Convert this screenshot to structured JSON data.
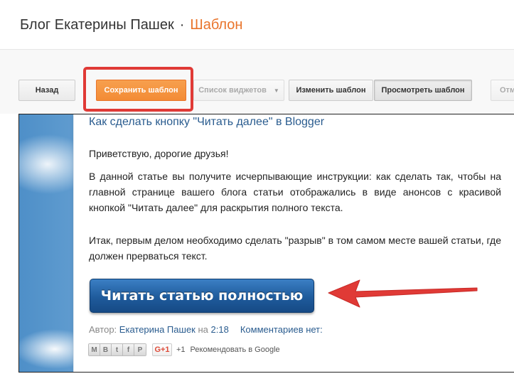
{
  "header": {
    "blog_name": "Блог Екатерины Пашек",
    "separator": "·",
    "section": "Шаблон"
  },
  "toolbar": {
    "back_label": "Назад",
    "save_label": "Сохранить шаблон",
    "widgets_label": "Список виджетов",
    "widgets_caret": "▼",
    "edit_label": "Изменить шаблон",
    "view_label": "Просмотреть шаблон",
    "more_label": "Отм"
  },
  "post": {
    "title": "Как сделать кнопку \"Читать далее\" в Blogger",
    "greeting": "Приветствую, дорогие друзья!",
    "paragraph1": "В данной статье вы получите исчерпывающие инструкции: как сделать так, чтобы на главной странице вашего блога статьи отображались в виде анонсов с красивой кнопкой \"Читать далее\" для раскрытия полного текста.",
    "paragraph2": "Итак, первым делом необходимо сделать \"разрыв\" в том самом месте вашей статьи, где должен прерваться текст.",
    "read_more_label": "Читать статью полностью",
    "author_prefix": "Автор:",
    "author": "Екатерина Пашек",
    "time_prefix": "на",
    "time": "2:18",
    "comments": "Комментариев нет:"
  },
  "share": {
    "icons": [
      "email-icon",
      "blogthis-icon",
      "twitter-icon",
      "facebook-icon",
      "pinterest-icon"
    ],
    "icon_glyphs": [
      "M",
      "B",
      "t",
      "f",
      "P"
    ],
    "gplus_label": "G+1",
    "gplus_count": "+1",
    "recommend_label": "Рекомендовать в Google"
  },
  "colors": {
    "accent": "#e9742b",
    "save_button": "#f38b35",
    "highlight": "#e03a36",
    "link": "#2a5c8f",
    "read_more_button": "#1f5b9c"
  }
}
